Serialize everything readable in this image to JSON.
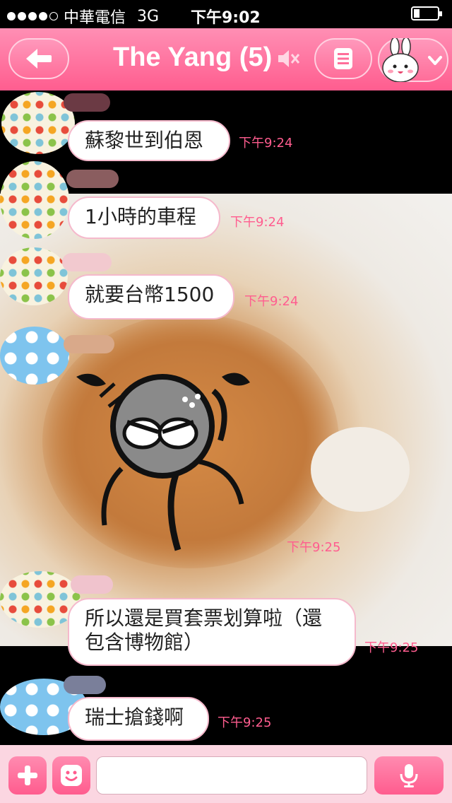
{
  "status_bar": {
    "carrier": "中華電信",
    "network": "3G",
    "time": "下午9:02",
    "signal_icon": "signal-dots-icon",
    "battery_icon": "battery-icon",
    "battery_level": 0.2
  },
  "header": {
    "title": "The Yang (5)",
    "back_icon": "back-arrow-icon",
    "mute_icon": "speaker-muted-icon",
    "menu_icon": "menu-list-icon",
    "sticker_icon": "bunny-sticker-icon",
    "colors": {
      "accent": "#ff5d8f",
      "accent_light": "#ff8fb4"
    }
  },
  "messages": [
    {
      "text": "蘇黎世到伯恩",
      "time": "下午9:24"
    },
    {
      "text": "1小時的車程",
      "time": "下午9:24"
    },
    {
      "text": "就要台幣1500",
      "time": "下午9:24"
    },
    {
      "text": "",
      "time": "下午9:25",
      "sticker": "stressed-character-sticker"
    },
    {
      "text": "所以還是買套票划算啦（還包含博物館）",
      "time": "下午9:25"
    },
    {
      "text": "瑞士搶錢啊",
      "time": "下午9:25"
    }
  ],
  "input_bar": {
    "plus_icon": "plus-icon",
    "emoji_icon": "emoji-icon",
    "mic_icon": "microphone-icon",
    "message_value": ""
  }
}
